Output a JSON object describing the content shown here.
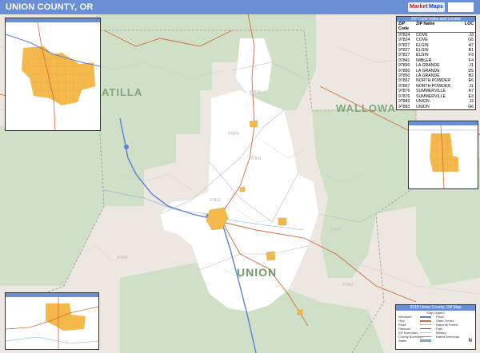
{
  "title": "UNION COUNTY, OR",
  "brand": {
    "name_red": "Market",
    "name_blue": "Maps",
    "box": ""
  },
  "regions": {
    "umatilla": "ATILLA",
    "wallowa": "WALLOWA",
    "union": "UNION"
  },
  "zip_labels": [
    "97824",
    "97876",
    "97841",
    "97850",
    "97824",
    "97883",
    "97862"
  ],
  "zip_table": {
    "title": "ZIP Code Index and Locator",
    "headers": [
      "ZIP Code",
      "ZIP Name",
      "LOC"
    ],
    "rows": [
      [
        "97824",
        "COVE",
        "J3"
      ],
      [
        "97824",
        "COVE",
        "G5"
      ],
      [
        "97827",
        "ELGIN",
        "A7"
      ],
      [
        "97827",
        "ELGIN",
        "B1"
      ],
      [
        "97827",
        "ELGIN",
        "F3"
      ],
      [
        "97841",
        "IMBLER",
        "F4"
      ],
      [
        "97850",
        "LA GRANDE",
        "J1"
      ],
      [
        "97850",
        "LA GRANDE",
        "D5"
      ],
      [
        "97850",
        "LA GRANDE",
        "B2"
      ],
      [
        "97867",
        "NORTH POWDER",
        "E6"
      ],
      [
        "97867",
        "NORTH POWDER",
        "J1"
      ],
      [
        "97876",
        "SUMMERVILLE",
        "A7"
      ],
      [
        "97876",
        "SUMMERVILLE",
        "E3"
      ],
      [
        "97883",
        "UNION",
        "J3"
      ],
      [
        "97883",
        "UNION",
        "G6"
      ]
    ]
  },
  "legend": {
    "title": "2018 Union County, OR Map",
    "subtitle": "Map Legend",
    "items": [
      "Interstate",
      "Hwy",
      "Road",
      "Railroad",
      "ZIP Boundary",
      "County Boundary",
      "Water"
    ],
    "right_items": [
      "Place",
      "State Forest",
      "National Forest",
      "Park",
      "Military",
      "Native American"
    ],
    "compass": "N"
  },
  "colors": {
    "title_bar": "#6a8fd6",
    "forest": "#cfe0c7",
    "land": "#ece7e1",
    "valley": "#ffffff",
    "city": "#f5b84a",
    "highway": "#d36b3a",
    "interstate": "#5a7fd6",
    "zip_border": "#bbbbbb"
  }
}
